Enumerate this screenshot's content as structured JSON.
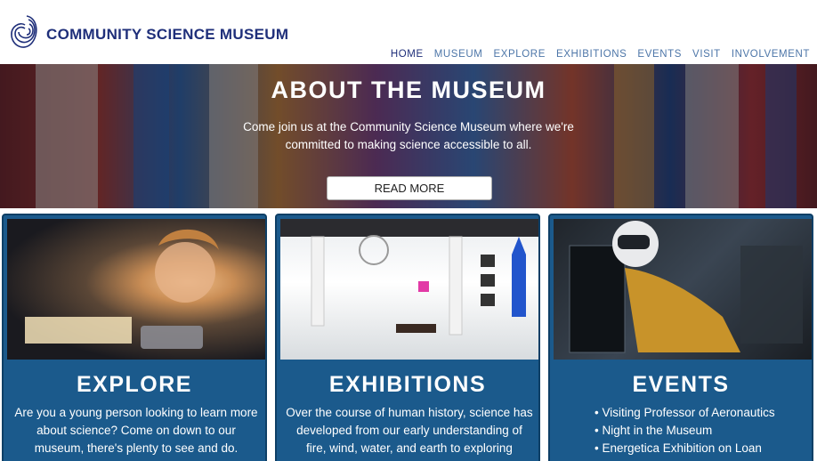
{
  "header": {
    "site_title": "COMMUNITY SCIENCE MUSEUM",
    "logo_icon": "spiral-logo-icon"
  },
  "nav": {
    "items": [
      {
        "label": "HOME",
        "active": true
      },
      {
        "label": "MUSEUM",
        "active": false
      },
      {
        "label": "EXPLORE",
        "active": false
      },
      {
        "label": "EXHIBITIONS",
        "active": false
      },
      {
        "label": "EVENTS",
        "active": false
      },
      {
        "label": "VISIT",
        "active": false
      },
      {
        "label": "INVOLVEMENT",
        "active": false
      }
    ]
  },
  "hero": {
    "title": "ABOUT THE MUSEUM",
    "text": "Come join us at the Community Science Museum where we're committed to making science accessible to all.",
    "button_label": "READ MORE"
  },
  "cards": [
    {
      "title": "EXPLORE",
      "text": "Are you a young person looking to learn more about science? Come on down to our museum, there's plenty to see and do."
    },
    {
      "title": "EXHIBITIONS",
      "text": "Over the course of human history, science has developed from our early understanding of fire, wind, water, and earth to exploring everything"
    },
    {
      "title": "EVENTS",
      "items": [
        "Visiting Professor of Aeronautics",
        "Night in the Museum",
        "Energetica Exhibition on Loan"
      ]
    }
  ],
  "colors": {
    "brand_navy": "#1f2f7a",
    "nav_blue": "#4d76a8",
    "card_blue": "#1b5a8c"
  }
}
